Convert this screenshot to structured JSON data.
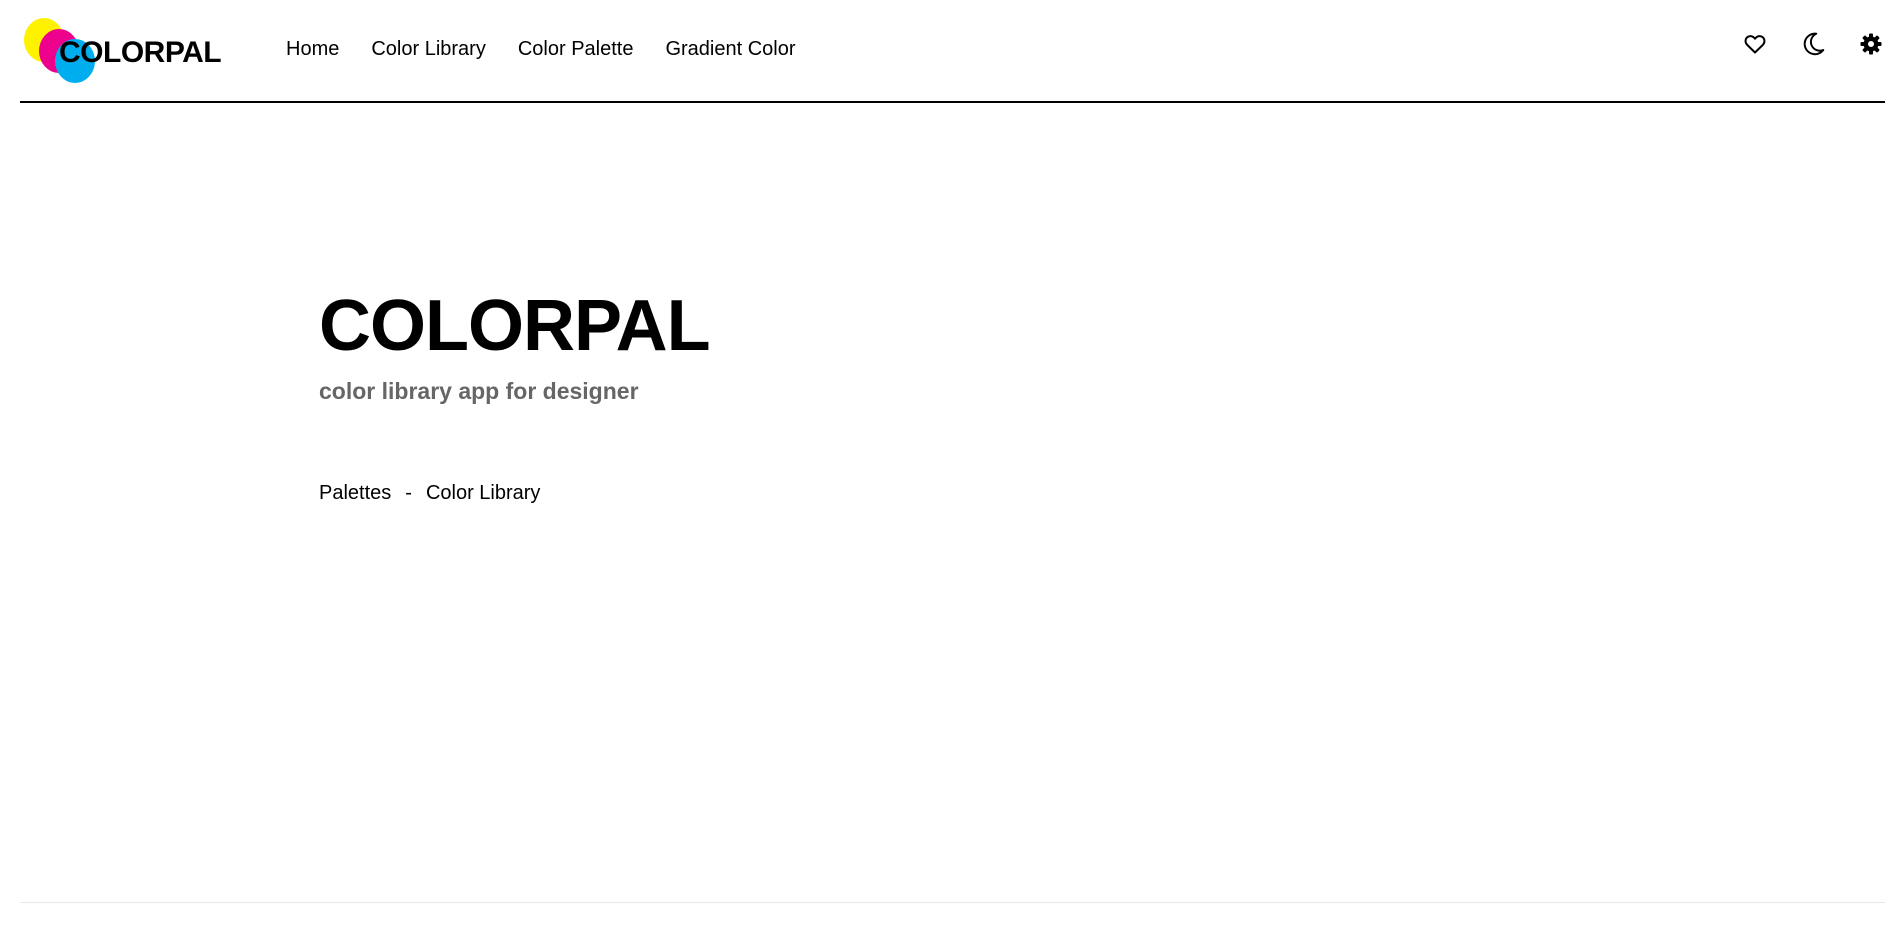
{
  "header": {
    "logo": {
      "text": "COLORPAL",
      "circle_colors": [
        "#FFF200",
        "#EC008C",
        "#00AEEF"
      ]
    },
    "nav": [
      {
        "label": "Home"
      },
      {
        "label": "Color Library"
      },
      {
        "label": "Color Palette"
      },
      {
        "label": "Gradient Color"
      }
    ],
    "actions": [
      {
        "icon": "heart-icon"
      },
      {
        "icon": "moon-icon"
      },
      {
        "icon": "gear-icon"
      }
    ]
  },
  "hero": {
    "title": "COLORPAL",
    "subtitle": "color library app for designer"
  },
  "links": {
    "first": "Palettes",
    "separator": "-",
    "second": "Color Library"
  },
  "colors": {
    "text": "#000000",
    "subtitle": "#666666",
    "divider": "#000000"
  }
}
